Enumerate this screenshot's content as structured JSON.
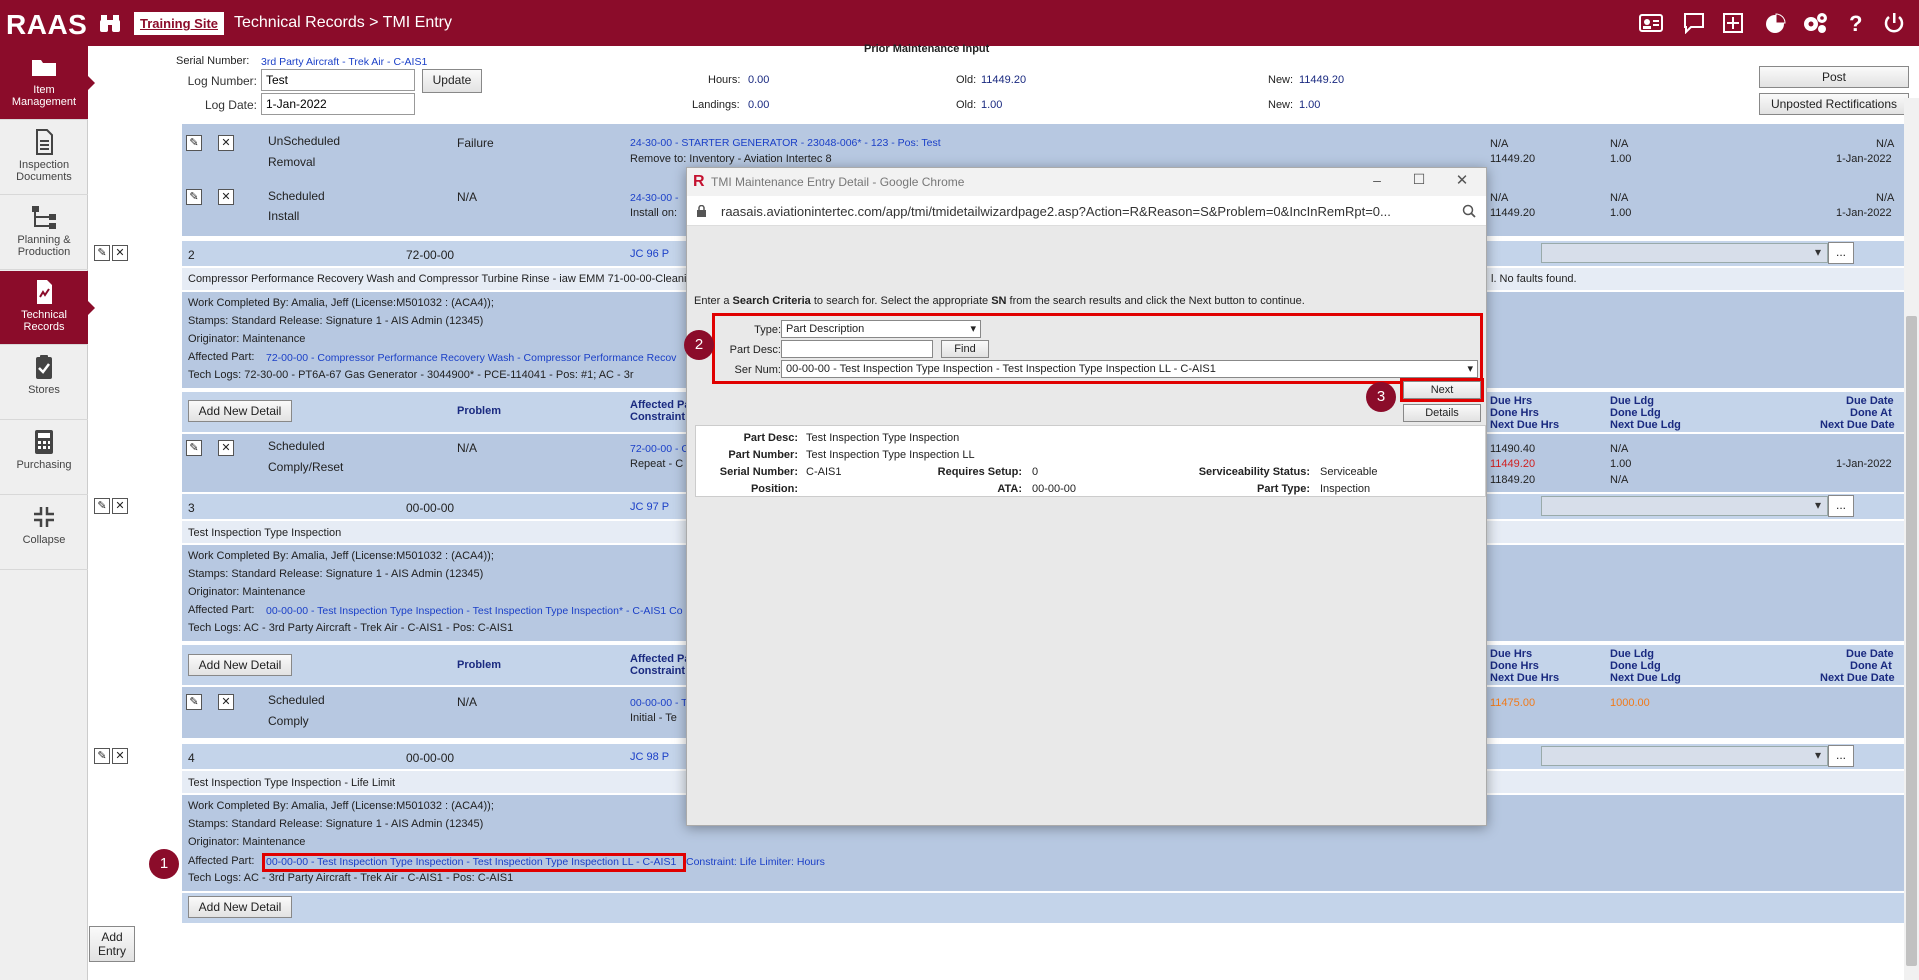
{
  "app": {
    "logo": "RAAS",
    "training_link": "Training Site",
    "breadcrumb": "Technical Records > TMI Entry"
  },
  "top_icons": [
    "id-card-icon",
    "chat-icon",
    "plus-square-icon",
    "pie-chart-icon",
    "gears-icon",
    "help-icon",
    "power-icon"
  ],
  "sidebar": [
    {
      "label": "Item Management",
      "icon": "folder-icon",
      "active": true
    },
    {
      "label": "Inspection Documents",
      "icon": "document-icon",
      "active": false
    },
    {
      "label": "Planning & Production",
      "icon": "hierarchy-icon",
      "active": false
    },
    {
      "label": "Technical Records",
      "icon": "records-icon",
      "active": true
    },
    {
      "label": "Stores",
      "icon": "clipboard-icon",
      "active": false
    },
    {
      "label": "Purchasing",
      "icon": "calculator-icon",
      "active": false
    },
    {
      "label": "Collapse",
      "icon": "collapse-icon",
      "active": false
    }
  ],
  "header": {
    "title": "Prior Maintenance Input",
    "serial_label": "Serial Number:",
    "serial_value": "3rd Party Aircraft - Trek Air - C-AIS1",
    "log_number_label": "Log Number:",
    "log_number_value": "Test",
    "update_label": "Update",
    "log_date_label": "Log Date:",
    "log_date_value": "1-Jan-2022",
    "hours_label": "Hours:",
    "hours_value": "0.00",
    "landings_label": "Landings:",
    "landings_value": "0.00",
    "old_label": "Old:",
    "old_hours": "11449.20",
    "old_landings": "1.00",
    "new_label": "New:",
    "new_hours": "11449.20",
    "new_landings": "1.00",
    "post_label": "Post",
    "unposted_label": "Unposted Rectifications"
  },
  "rows_top": [
    {
      "type": "UnScheduled",
      "sub": "Removal",
      "problem": "Failure",
      "part": "24-30-00 - STARTER GENERATOR - 23048-006* - 123 - Pos: Test",
      "detail": "Remove to: Inventory - Aviation Intertec 8",
      "c1": "N/A",
      "c1b": "11449.20",
      "c2": "N/A",
      "c2b": "1.00",
      "c3": "N/A",
      "c3b": "1-Jan-2022"
    },
    {
      "type": "Scheduled",
      "sub": "Install",
      "problem": "N/A",
      "part": "24-30-00 -",
      "detail": "Install on:",
      "c1": "N/A",
      "c1b": "11449.20",
      "c2": "N/A",
      "c2b": "1.00",
      "c3": "N/A",
      "c3b": "1-Jan-2022"
    }
  ],
  "entries": [
    {
      "num": "2",
      "ata": "72-00-00",
      "jc": "JC 96 P",
      "title": "Compressor Performance Recovery Wash and Compressor Turbine Rinse - iaw EMM 71-00-00-Cleaning,",
      "title_tail": "l. No faults found.",
      "work": "Work Completed By: Amalia, Jeff (License:M501032 : (ACA4));",
      "stamps": "Stamps: Standard Release: Signature 1 - AIS Admin (12345)",
      "originator": "Originator: Maintenance",
      "affected_label": "Affected Part:",
      "affected": "72-00-00 - Compressor Performance Recovery Wash - Compressor Performance Recov",
      "techlogs": "Tech Logs: 72-30-00 - PT6A-67 Gas Generator - 3044900* - PCE-114041 - Pos: #1; AC - 3r",
      "add_label": "Add New Detail",
      "problem_h": "Problem",
      "affected_h1": "Affected Pa",
      "affected_h2": "Constraint",
      "d_type": "Scheduled",
      "d_sub": "Comply/Reset",
      "d_problem": "N/A",
      "d_part": "72-00-00 - C",
      "d_detail": "Repeat - C",
      "h1": [
        "Due Hrs",
        "Done Hrs",
        "Next Due Hrs"
      ],
      "h2": [
        "Due Ldg",
        "Done Ldg",
        "Next Due Ldg"
      ],
      "h3": [
        "Due Date",
        "Done At",
        "Next Due Date"
      ],
      "v1": [
        "11490.40",
        "11449.20",
        "11849.20"
      ],
      "v2": [
        "N/A",
        "1.00",
        "N/A"
      ],
      "v3": [
        "",
        "1-Jan-2022",
        ""
      ]
    },
    {
      "num": "3",
      "ata": "00-00-00",
      "jc": "JC 97 P",
      "title": "Test Inspection Type Inspection",
      "work": "Work Completed By: Amalia, Jeff (License:M501032 : (ACA4));",
      "stamps": "Stamps: Standard Release: Signature 1 - AIS Admin (12345)",
      "originator": "Originator: Maintenance",
      "affected_label": "Affected Part:",
      "affected": "00-00-00 - Test Inspection Type Inspection - Test Inspection Type Inspection* - C-AIS1 Co",
      "techlogs": "Tech Logs: AC - 3rd Party Aircraft - Trek Air - C-AIS1 - Pos: C-AIS1",
      "add_label": "Add New Detail",
      "problem_h": "Problem",
      "affected_h1": "Affected Pa",
      "affected_h2": "Constraint",
      "d_type": "Scheduled",
      "d_sub": "Comply",
      "d_problem": "N/A",
      "d_part": "00-00-00 - T",
      "d_detail": "Initial - Te",
      "h1": [
        "Due Hrs",
        "Done Hrs",
        "Next Due Hrs"
      ],
      "h2": [
        "Due Ldg",
        "Done Ldg",
        "Next Due Ldg"
      ],
      "h3": [
        "Due Date",
        "Done At",
        "Next Due Date"
      ],
      "v1": [
        "11475.00"
      ],
      "v2": [
        "1000.00"
      ]
    },
    {
      "num": "4",
      "ata": "00-00-00",
      "jc": "JC 98 P",
      "title": "Test Inspection Type Inspection - Life Limit",
      "work": "Work Completed By: Amalia, Jeff (License:M501032 : (ACA4));",
      "stamps": "Stamps: Standard Release: Signature 1 - AIS Admin (12345)",
      "originator": "Originator: Maintenance",
      "affected_label": "Affected Part:",
      "affected": "00-00-00 - Test Inspection Type Inspection - Test Inspection Type Inspection LL - C-AIS1",
      "affected_tail": "Constraint: Life Limiter: Hours",
      "techlogs": "Tech Logs: AC - 3rd Party Aircraft - Trek Air - C-AIS1 - Pos: C-AIS1",
      "add_label": "Add New Detail"
    }
  ],
  "add_entry_label": "Add Entry",
  "popup": {
    "title": "TMI Maintenance Entry Detail - Google Chrome",
    "url": "raasais.aviationintertec.com/app/tmi/tmidetailwizardpage2.asp?Action=R&Reason=S&Problem=0&IncInRemRpt=0...",
    "instr_a": "Enter a ",
    "instr_b": "Search Criteria",
    "instr_c": " to search for. Select the appropriate ",
    "instr_d": "SN",
    "instr_e": " from the search results and click the Next button to continue.",
    "type_label": "Type:",
    "type_value": "Part Description",
    "partdesc_label": "Part Desc:",
    "find_label": "Find",
    "sernum_label": "Ser Num:",
    "sernum_value": "00-00-00 - Test Inspection Type Inspection - Test Inspection Type Inspection LL - C-AIS1",
    "next_label": "Next",
    "details_label": "Details",
    "info": {
      "part_desc_label": "Part Desc:",
      "part_desc": "Test Inspection Type Inspection",
      "part_number_label": "Part Number:",
      "part_number": "Test Inspection Type Inspection LL",
      "serial_label": "Serial Number:",
      "serial": "C-AIS1",
      "setup_label": "Requires Setup:",
      "setup": "0",
      "svc_label": "Serviceability Status:",
      "svc": "Serviceable",
      "position_label": "Position:",
      "ata_label": "ATA:",
      "ata": "00-00-00",
      "ptype_label": "Part Type:",
      "ptype": "Inspection"
    }
  },
  "callouts": [
    "1",
    "2",
    "3"
  ],
  "colors": {
    "brand": "#8b0c2a",
    "row_band": "#b7c8e1",
    "link": "#1a3fc7",
    "highlight": "#e00000"
  }
}
